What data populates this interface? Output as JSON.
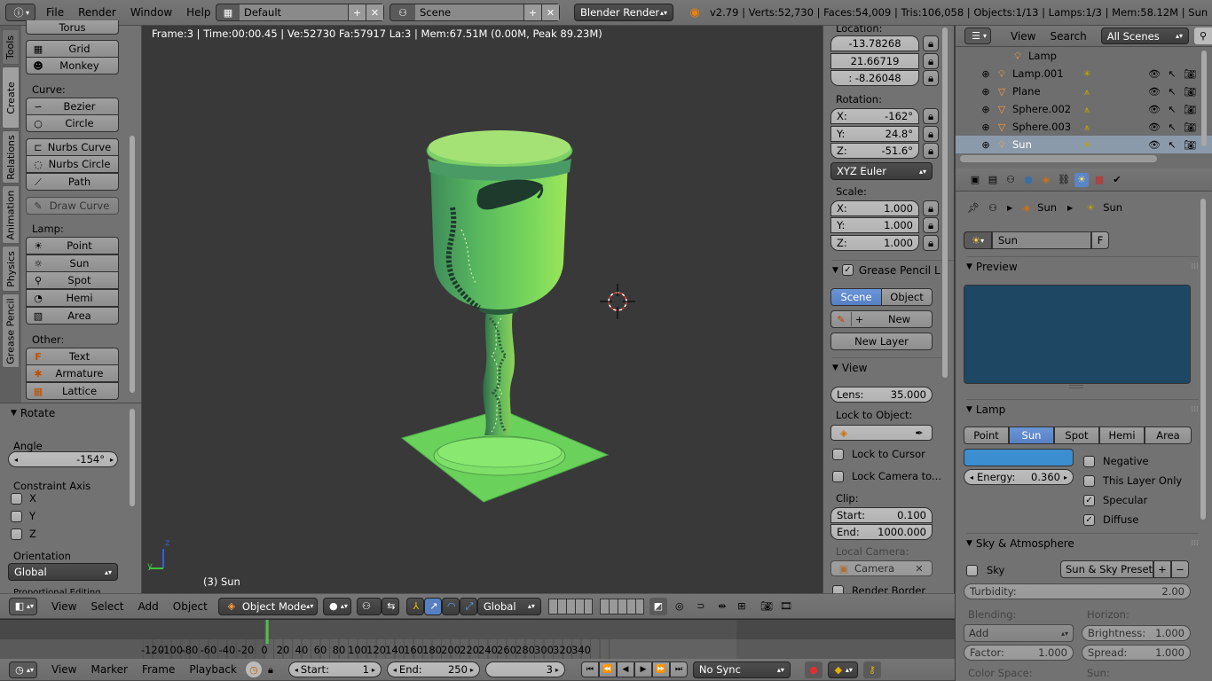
{
  "topbar": {
    "menus": [
      "File",
      "Render",
      "Window",
      "Help"
    ],
    "screen_layout": "Default",
    "scene": "Scene",
    "engine": "Blender Render",
    "stats": "v2.79 | Verts:52,730 | Faces:54,009 | Tris:106,058 | Objects:1/13 | Lamps:1/3 | Mem:58.12M | Sun"
  },
  "toolshelf": {
    "tabs": [
      "Tools",
      "Create",
      "Relations",
      "Animation",
      "Physics",
      "Grease Pencil"
    ],
    "mesh_items": [
      "Torus",
      "Grid",
      "Monkey"
    ],
    "curve_label": "Curve:",
    "curve_items": [
      "Bezier",
      "Circle"
    ],
    "curve_items2": [
      "Nurbs Curve",
      "Nurbs Circle",
      "Path"
    ],
    "draw_curve": "Draw Curve",
    "lamp_label": "Lamp:",
    "lamp_items": [
      "Point",
      "Sun",
      "Spot",
      "Hemi",
      "Area"
    ],
    "other_label": "Other:",
    "other_items": [
      "Text",
      "Armature",
      "Lattice"
    ]
  },
  "operator": {
    "title": "Rotate",
    "angle_label": "Angle",
    "angle_value": "-154°",
    "constraint_label": "Constraint Axis",
    "axes": [
      "X",
      "Y",
      "Z"
    ],
    "orientation_label": "Orientation",
    "orientation_value": "Global",
    "cut_text": "Proportional Editing"
  },
  "viewport": {
    "info": "Frame:3 | Time:00:00.45 | Ve:52730 Fa:57917 La:3 | Mem:67.51M (0.00M, Peak 89.23M)",
    "object_label": "(3) Sun",
    "axis_z": "z",
    "axis_y": "y"
  },
  "properties_n": {
    "location_label": "Location:",
    "loc": [
      "-13.78268",
      "21.66719",
      ": -8.26048"
    ],
    "rotation_label": "Rotation:",
    "rot": [
      {
        "axis": "X:",
        "value": "-162°"
      },
      {
        "axis": "Y:",
        "value": "24.8°"
      },
      {
        "axis": "Z:",
        "value": "-51.6°"
      }
    ],
    "rot_mode": "XYZ Euler",
    "scale_label": "Scale:",
    "scale": [
      {
        "axis": "X:",
        "value": "1.000"
      },
      {
        "axis": "Y:",
        "value": "1.000"
      },
      {
        "axis": "Z:",
        "value": "1.000"
      }
    ],
    "gp_title": "Grease Pencil L",
    "gp_scene": "Scene",
    "gp_object": "Object",
    "gp_new": "New",
    "gp_new_layer": "New Layer",
    "view_title": "View",
    "lens_label": "Lens:",
    "lens_value": "35.000",
    "lock_obj_label": "Lock to Object:",
    "lock_cursor": "Lock to Cursor",
    "lock_camera": "Lock Camera to...",
    "clip_label": "Clip:",
    "clip_start_label": "Start:",
    "clip_start": "0.100",
    "clip_end_label": "End:",
    "clip_end": "1000.000",
    "local_camera_label": "Local Camera:",
    "local_camera": "Camera",
    "render_border": "Render Border"
  },
  "outliner": {
    "menus": [
      "View",
      "Search"
    ],
    "filter": "All Scenes",
    "items": [
      {
        "name": "Lamp",
        "icon": "lamp-icon",
        "color": "#ffa040"
      },
      {
        "name": "Lamp.001",
        "icon": "lamp-icon",
        "color": "#ffa040"
      },
      {
        "name": "Plane",
        "icon": "mesh-icon",
        "color": "#ff9a3a"
      },
      {
        "name": "Sphere.002",
        "icon": "mesh-icon",
        "color": "#ff9a3a"
      },
      {
        "name": "Sphere.003",
        "icon": "mesh-icon",
        "color": "#ff9a3a"
      },
      {
        "name": "Sun",
        "icon": "lamp-icon",
        "color": "#ffa040"
      }
    ]
  },
  "props_editor": {
    "breadcrumb": [
      "Sun",
      "Sun"
    ],
    "datablock": "Sun",
    "fake_user": "F",
    "preview_title": "Preview",
    "preview_color": "#1e4763",
    "lamp_title": "Lamp",
    "lamp_types": [
      "Point",
      "Sun",
      "Spot",
      "Hemi",
      "Area"
    ],
    "lamp_color": "#3b8ecf",
    "energy_label": "Energy:",
    "energy_value": "0.360",
    "checks": [
      {
        "label": "Negative",
        "checked": false
      },
      {
        "label": "This Layer Only",
        "checked": false
      },
      {
        "label": "Specular",
        "checked": true
      },
      {
        "label": "Diffuse",
        "checked": true
      }
    ],
    "sky_title": "Sky & Atmosphere",
    "sky_label": "Sky",
    "sky_presets": "Sun & Sky Presets",
    "turbidity_label": "Turbidity:",
    "turbidity_value": "2.00",
    "blending_label": "Blending:",
    "horizon_label": "Horizon:",
    "blend_mode": "Add",
    "brightness_label": "Brightness:",
    "brightness_value": "1.000",
    "factor_label": "Factor:",
    "factor_value": "1.000",
    "spread_label": "Spread:",
    "spread_value": "1.000",
    "color_space_label": "Color Space:",
    "sun_label": "Sun:"
  },
  "view_header": {
    "menus": [
      "View",
      "Select",
      "Add",
      "Object"
    ],
    "mode": "Object Mode",
    "orientation": "Global"
  },
  "timeline": {
    "ticks": [
      "-120",
      "-100",
      "-80",
      "-60",
      "-40",
      "-20",
      "0",
      "20",
      "40",
      "60",
      "80",
      "100",
      "120",
      "140",
      "160",
      "180",
      "200",
      "220",
      "240",
      "260",
      "280",
      "300",
      "320",
      "340"
    ],
    "tick_values": [
      -120,
      -100,
      -80,
      -60,
      -40,
      -20,
      0,
      20,
      40,
      60,
      80,
      100,
      120,
      140,
      160,
      180,
      200,
      220,
      240,
      260,
      280,
      300,
      320,
      340
    ],
    "current_frame": 3,
    "menus": [
      "View",
      "Marker",
      "Frame",
      "Playback"
    ],
    "start_label": "Start:",
    "start": "1",
    "end_label": "End:",
    "end": "250",
    "frame": "3",
    "sync": "No Sync"
  }
}
